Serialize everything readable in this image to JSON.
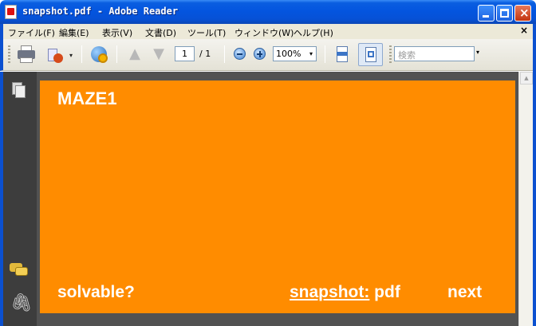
{
  "window": {
    "title": "snapshot.pdf - Adobe Reader"
  },
  "menu": {
    "items": [
      "ファイル(F)",
      "編集(E)",
      "表示(V)",
      "文書(D)",
      "ツール(T)",
      "ウィンドウ(W)",
      "ヘルプ(H)"
    ],
    "close_glyph": "×"
  },
  "toolbar": {
    "page_current": "1",
    "page_total": "/ 1",
    "zoom": "100%",
    "search_placeholder": "検索",
    "caret": "▾"
  },
  "document": {
    "title": "MAZE1",
    "link_solvable": "solvable?",
    "link_snapshot_underlined": "snapshot:",
    "link_snapshot_rest": " pdf",
    "link_next": "next",
    "background": "#ff8c00"
  },
  "icons": {
    "up": "▲",
    "down": "▼",
    "attach": "🖇",
    "scroll_up": "▲"
  }
}
